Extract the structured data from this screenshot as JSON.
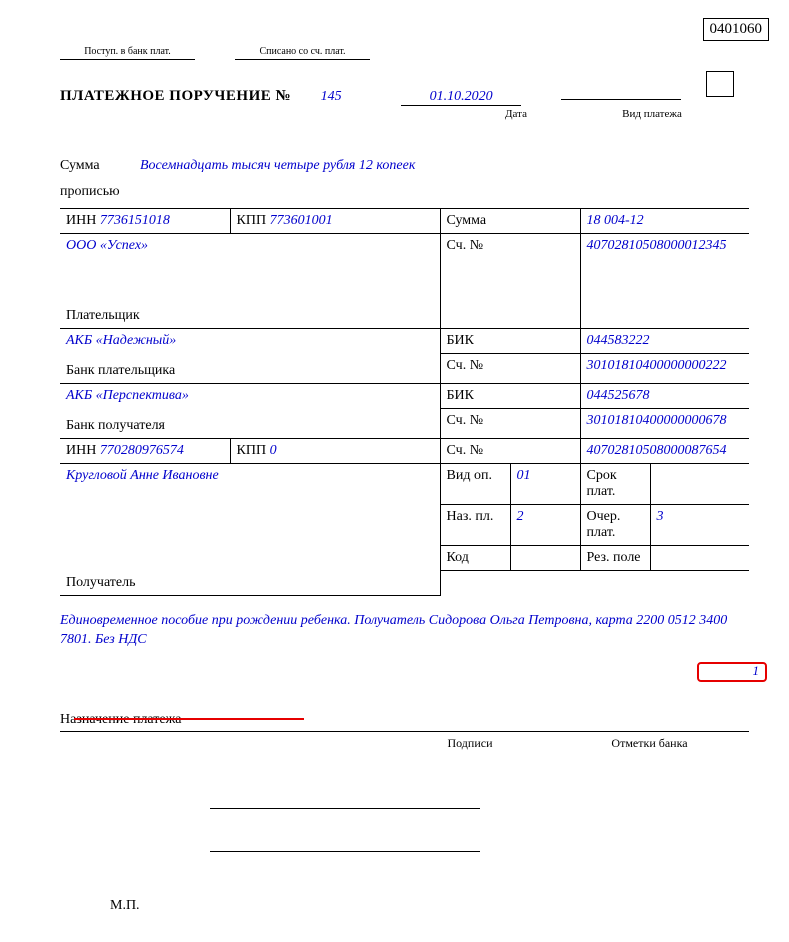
{
  "form_code": "0401060",
  "top": {
    "postup": "Поступ. в банк плат.",
    "spisano": "Списано со сч. плат."
  },
  "title": "ПЛАТЕЖНОЕ ПОРУЧЕНИЕ №",
  "number": "145",
  "date": "01.10.2020",
  "date_label": "Дата",
  "type_label": "Вид платежа",
  "amount_word_lbl1": "Сумма",
  "amount_word_lbl2": "прописью",
  "amount_words": "Восемнадцать тысяч четыре рубля 12 копеек",
  "row1": {
    "inn_lbl": "ИНН",
    "inn": "7736151018",
    "kpp_lbl": "КПП",
    "kpp": "773601001",
    "sum_lbl": "Сумма",
    "sum": "18 004-12"
  },
  "payer_name": "ООО «Успех»",
  "acct_lbl": "Сч. №",
  "payer_acct": "40702810508000012345",
  "payer_role": "Плательщик",
  "payer_bank": "АКБ «Надежный»",
  "bik_lbl": "БИК",
  "payer_bank_bik": "044583222",
  "payer_bank_acct": "30101810400000000222",
  "payer_bank_role": "Банк плательщика",
  "recv_bank": "АКБ «Перспектива»",
  "recv_bank_bik": "044525678",
  "recv_bank_acct": "30101810400000000678",
  "recv_bank_role": "Банк получателя",
  "row2": {
    "inn_lbl": "ИНН",
    "inn": "770280976574",
    "kpp_lbl": "КПП",
    "kpp": "0",
    "recv_acct": "40702810508000087654"
  },
  "recv_name": "Кругловой Анне Ивановне",
  "recv_role": "Получатель",
  "op": {
    "vid_lbl": "Вид оп.",
    "vid": "01",
    "naz_lbl": "Наз. пл.",
    "naz": "2",
    "kod_lbl": "Код",
    "srok_lbl": "Срок плат.",
    "ocher_lbl": "Очер. плат.",
    "ocher": "3",
    "rez_lbl": "Рез. поле"
  },
  "marker": "1",
  "purpose_text": "Единовременное пособие при рождении ребенка. Получатель Сидорова Ольга Петровна, карта 2200 0512 3400 7801. Без НДС",
  "purpose_label": "Назначение платежа",
  "sig": {
    "podpisi": "Подписи",
    "otmetki": "Отметки банка",
    "mp": "М.П."
  }
}
